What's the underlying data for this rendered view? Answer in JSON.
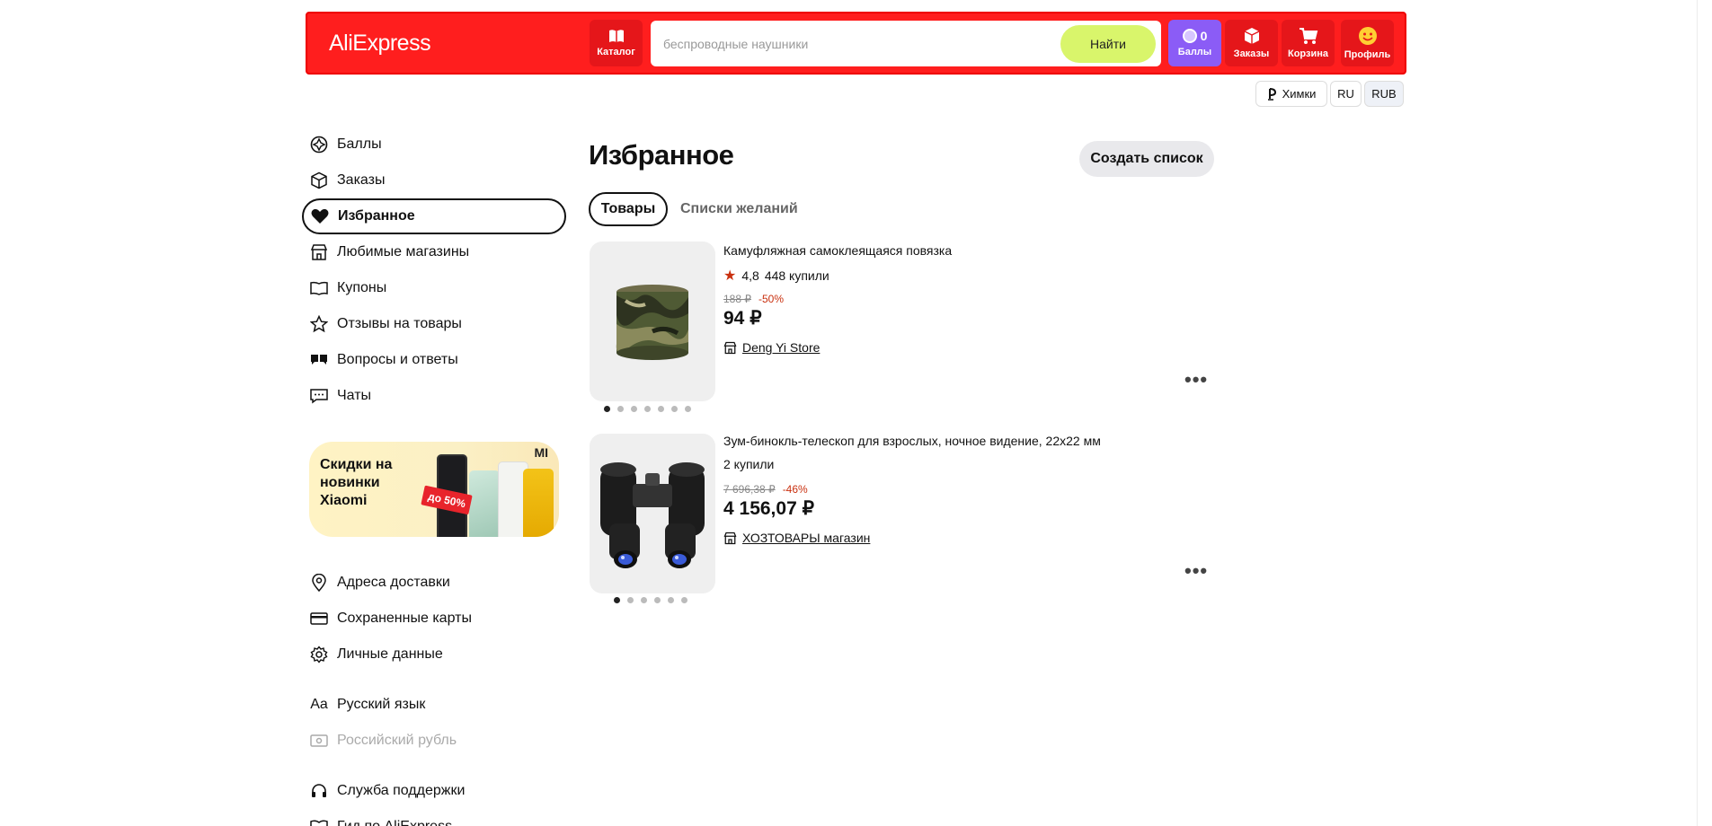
{
  "header": {
    "logo": "AliExpress",
    "catalog_label": "Каталог",
    "search_placeholder": "беспроводные наушники",
    "search_button": "Найти",
    "points_count": "0",
    "points_label": "Баллы",
    "orders_label": "Заказы",
    "cart_label": "Корзина",
    "profile_label": "Профиль",
    "accent_color": "#ff1e1e"
  },
  "subheader": {
    "city": "Химки",
    "language": "RU",
    "currency": "RUB"
  },
  "sidebar": {
    "items": [
      {
        "label": "Баллы",
        "icon": "points-icon"
      },
      {
        "label": "Заказы",
        "icon": "box-icon"
      },
      {
        "label": "Избранное",
        "icon": "heart-icon"
      },
      {
        "label": "Любимые магазины",
        "icon": "store-icon"
      },
      {
        "label": "Купоны",
        "icon": "coupon-icon"
      },
      {
        "label": "Отзывы на товары",
        "icon": "star-icon"
      },
      {
        "label": "Вопросы и ответы",
        "icon": "qa-icon"
      },
      {
        "label": "Чаты",
        "icon": "chat-icon"
      }
    ],
    "promo": {
      "text": "Скидки на новинки Xiaomi",
      "badge": "до 50%",
      "brand": "MI"
    },
    "settings": [
      {
        "label": "Адреса доставки",
        "icon": "location-icon"
      },
      {
        "label": "Сохраненные карты",
        "icon": "card-icon"
      },
      {
        "label": "Личные данные",
        "icon": "gear-icon"
      }
    ],
    "locale": [
      {
        "label": "Русский язык",
        "icon": "language-icon"
      },
      {
        "label": "Российский рубль",
        "icon": "currency-icon"
      }
    ],
    "support": [
      {
        "label": "Служба поддержки",
        "icon": "headset-icon"
      },
      {
        "label": "Гид по AliExpress",
        "icon": "guide-icon"
      }
    ]
  },
  "main": {
    "title": "Избранное",
    "create_list": "Создать список",
    "tabs": [
      "Товары",
      "Списки желаний"
    ],
    "products": [
      {
        "title": "Камуфляжная самоклеящаяся повязка",
        "rating": "4,8",
        "sold": "448 купили",
        "old_price": "188 ₽",
        "discount": "-50%",
        "price": "94 ₽",
        "store": "Deng Yi Store"
      },
      {
        "title": "Зум-бинокль-телескоп для взрослых, ночное видение, 22x22 мм",
        "sold": "2 купили",
        "old_price": "7 696,38 ₽",
        "discount": "-46%",
        "price": "4 156,07 ₽",
        "store": "ХОЗТОВАРЫ магазин"
      }
    ]
  }
}
